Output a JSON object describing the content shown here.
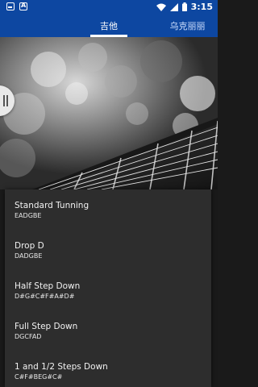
{
  "status_bar": {
    "time": "3:15",
    "left_icons": [
      "app-notification-icon",
      "text-notification-icon"
    ],
    "right_icons": [
      "wifi-icon",
      "signal-icon",
      "battery-icon"
    ]
  },
  "tabs": [
    {
      "label": "吉他",
      "selected": true
    },
    {
      "label": "乌克丽丽",
      "selected": false
    }
  ],
  "colors": {
    "app_bar": "#0d47a1",
    "panel": "#2d2d2d",
    "text": "#f2f2f2"
  },
  "tunings": [
    {
      "name": "Standard Tunning",
      "notes": "EADGBE"
    },
    {
      "name": "Drop D",
      "notes": "DADGBE"
    },
    {
      "name": "Half Step Down",
      "notes": "D#G#C#F#A#D#"
    },
    {
      "name": "Full Step Down",
      "notes": "DGCFAD"
    },
    {
      "name": "1 and 1/2 Steps Down",
      "notes": "C#F#BEG#C#"
    }
  ]
}
